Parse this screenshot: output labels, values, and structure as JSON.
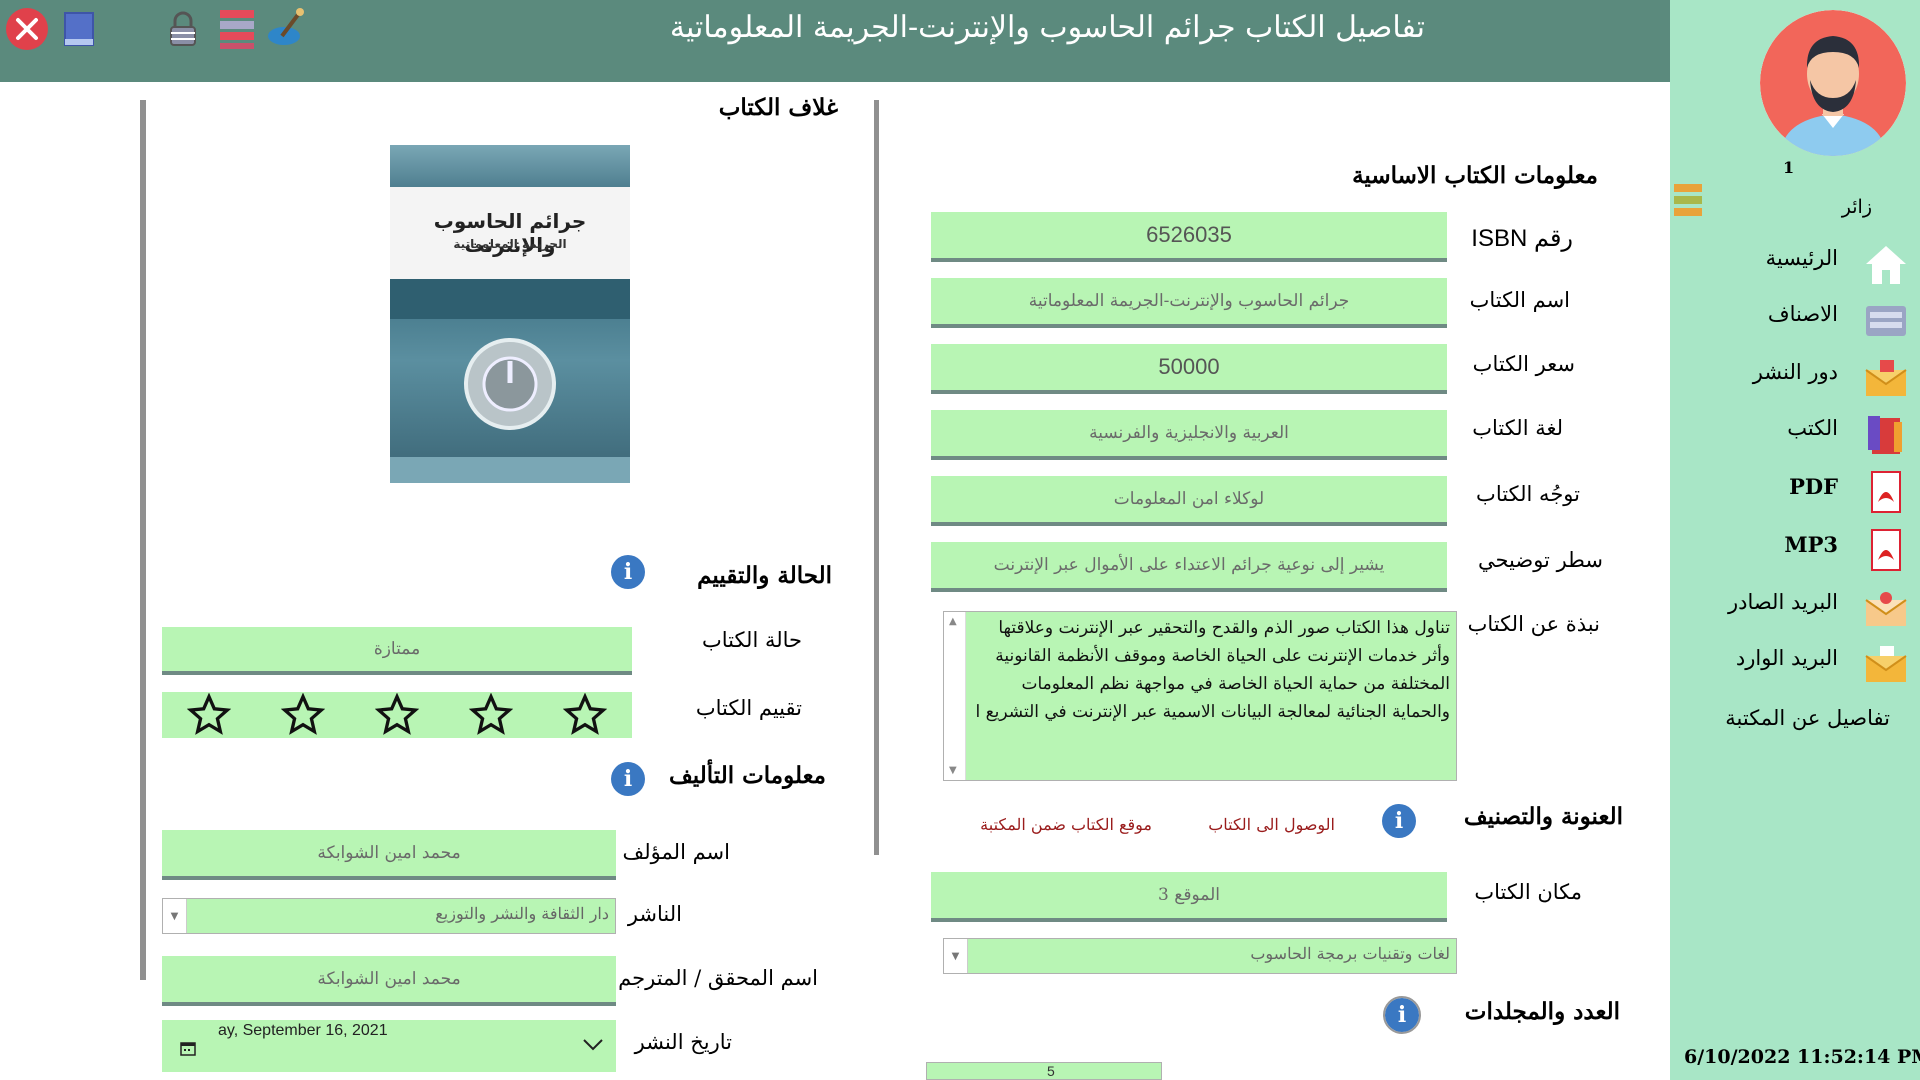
{
  "window": {
    "title": "تفاصيل الكتاب جرائم الحاسوب والإنترنت-الجريمة المعلوماتية"
  },
  "toolbar_icons": [
    "close-icon",
    "minimize-icon",
    "lock-icon",
    "list-icon",
    "paint-icon"
  ],
  "sidebar": {
    "user_count": "1",
    "user_role": "زائر",
    "items": [
      {
        "label": "الرئيسية",
        "icon": "home-icon"
      },
      {
        "label": "الاصناف",
        "icon": "drawer-icon"
      },
      {
        "label": "دور النشر",
        "icon": "mail-icon"
      },
      {
        "label": "الكتب",
        "icon": "books-icon"
      },
      {
        "label": "PDF",
        "icon": "pdf-icon"
      },
      {
        "label": "MP3",
        "icon": "mp3-icon"
      },
      {
        "label": "البريد الصادر",
        "icon": "outbox-icon"
      },
      {
        "label": "البريد الوارد",
        "icon": "inbox-icon"
      },
      {
        "label": "تفاصيل عن المكتبة",
        "icon": ""
      }
    ],
    "datetime": "6/10/2022 11:52:14 PM"
  },
  "cover": {
    "heading": "غلاف الكتاب",
    "book_title": "جرائم الحاسوب والإنترنت",
    "book_subtitle": "الجريمة المعلوماتية"
  },
  "basic_info": {
    "heading": "معلومات الكتاب الاساسية",
    "isbn_label": "رقم ISBN",
    "isbn": "6526035",
    "name_label": "اسم الكتاب",
    "name": "جرائم الحاسوب والإنترنت-الجريمة المعلوماتية",
    "price_label": "سعر الكتاب",
    "price": "50000",
    "language_label": "لغة الكتاب",
    "language": "العربية والانجليزية والفرنسية",
    "audience_label": "توجُه الكتاب",
    "audience": "لوكلاء امن المعلومات",
    "tagline_label": "سطر توضيحي",
    "tagline": "يشير إلى نوعية جرائم الاعتداء على الأموال عبر الإنترنت",
    "about_label": "نبذة عن الكتاب",
    "about": "تناول هذا الكتاب صور الذم والقدح والتحقير عبر الإنترنت وعلاقتها وأثر خدمات الإنترنت على الحياة الخاصة وموقف الأنظمة القانونية المختلفة من حماية الحياة الخاصة في مواجهة نظم المعلومات والحماية الجنائية لمعالجة البيانات الاسمية عبر الإنترنت في التشريع ا"
  },
  "addressing": {
    "heading": "العنونة والتصنيف",
    "link_access": "الوصول الى الكتاب",
    "link_location": "موقع الكتاب ضمن المكتبة",
    "place_label": "مكان الكتاب",
    "place": "الموقع 3",
    "category": "لغات وتقنيات برمجة الحاسوب"
  },
  "counts": {
    "heading": "العدد والمجلدات",
    "volumes_value": "5"
  },
  "status": {
    "heading": "الحالة والتقييم",
    "state_label": "حالة الكتاب",
    "state": "ممتازة",
    "rating_label": "تقييم الكتاب",
    "rating": 0,
    "max_rating": 5
  },
  "authoring": {
    "heading": "معلومات التأليف",
    "author_label": "اسم المؤلف",
    "author": "محمد امين الشوابكة",
    "publisher_label": "الناشر",
    "publisher": "دار الثقافة والنشر والتوزيع",
    "editor_label": "اسم المحقق / المترجم",
    "editor": "محمد امين الشوابكة",
    "date_label": "تاريخ النشر",
    "date": "ay, September 16, 2021"
  }
}
